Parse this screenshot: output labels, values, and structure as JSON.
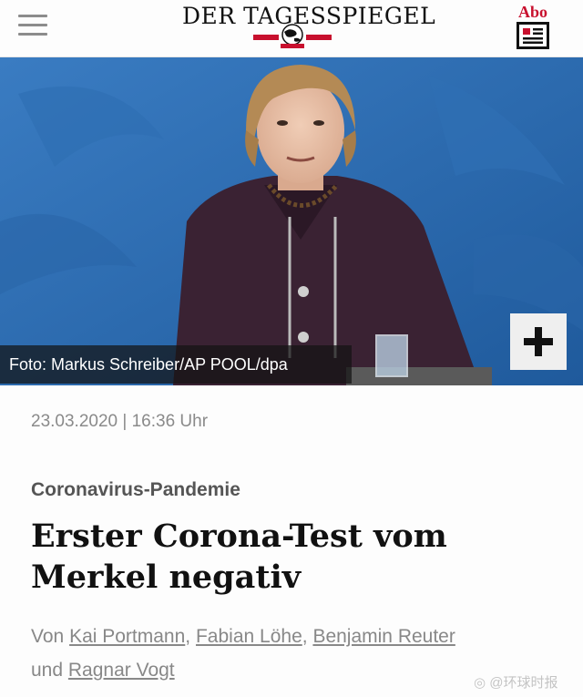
{
  "header": {
    "logo_text": "DER TAGESSPIEGEL",
    "abo_label": "Abo",
    "brand_color": "#c8102e"
  },
  "hero": {
    "caption": "Foto: Markus Schreiber/AP POOL/dpa",
    "expand_symbol": "+",
    "background_color": "#2d6fb5"
  },
  "article": {
    "date": "23.03.2020 | 16:36 Uhr",
    "kicker": "Coronavirus-Pandemie",
    "headline_line1": "Erster Corona-Test vom",
    "headline_line2": "Merkel negativ",
    "byline": {
      "prefix": "Von",
      "authors": [
        "Kai Portmann",
        "Fabian Löhe",
        "Benjamin Reuter",
        "Ragnar Vogt"
      ],
      "sep1": ",",
      "sep2": ",",
      "conjunction": "und"
    }
  },
  "watermark": "@环球时报",
  "icons": [
    "hamburger-menu-icon",
    "globe-emblem-icon",
    "newspaper-icon",
    "plus-icon",
    "weibo-icon"
  ]
}
